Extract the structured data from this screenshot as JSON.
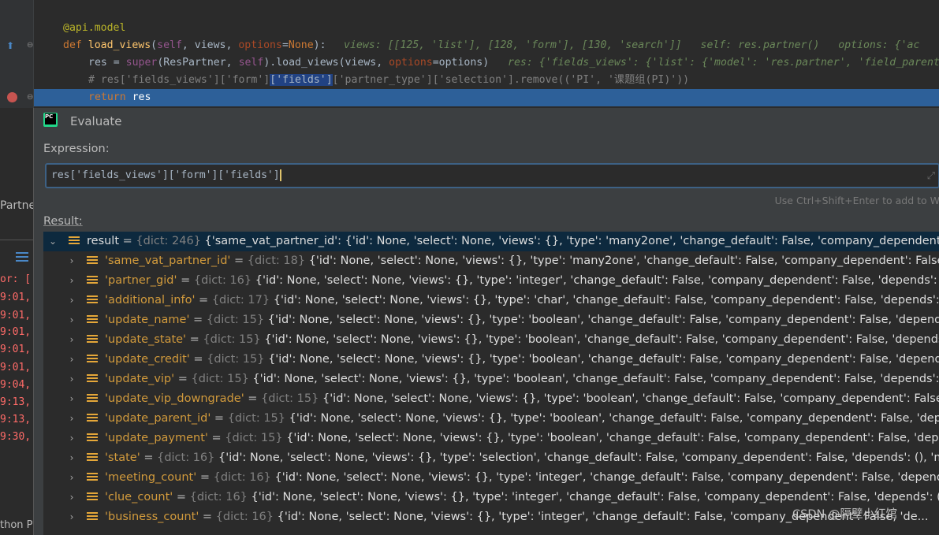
{
  "editor": {
    "lines": [
      {
        "code": "@api.model"
      },
      {
        "code": "def load_views(self, views, options=None):",
        "hint": "views: [[125, 'list'], [128, 'form'], [130, 'search']]   self: res.partner()   options: {'ac"
      },
      {
        "code": "res = super(ResPartner, self).load_views(views, options=options)",
        "hint": "res: {'fields_views': {'list': {'model': 'res.partner', 'field_parent"
      },
      {
        "code": "# res['fields_views']['form']['fields']['partner_type']['selection'].remove(('PI', '课题组(PI)'))"
      },
      {
        "code": "return res"
      }
    ]
  },
  "left_panel": {
    "partner_label": "Partne",
    "error_fragment": "or: [",
    "time_fragments": [
      "9:01,",
      "9:01,",
      "9:01,",
      "9:01,",
      "9:01,",
      "9:04,",
      "9:13,",
      "9:13,",
      "9:30,"
    ],
    "bottom_fragment": "thon P"
  },
  "dialog": {
    "title": "Evaluate",
    "expression_label": "Expression:",
    "expression_value": "res['fields_views']['form']['fields']",
    "hint": "Use Ctrl+Shift+Enter to add to W",
    "result_label": "Result:",
    "result": {
      "name": "result",
      "type": "{dict: 246}",
      "preview": "{'same_vat_partner_id': {'id': None, 'select': None, 'views': {}, 'type': 'many2one', 'change_default': False, 'company_dependent': Fa..."
    },
    "items": [
      {
        "key": "'same_vat_partner_id'",
        "type": "{dict: 18}",
        "preview": "{'id': None, 'select': None, 'views': {}, 'type': 'many2one', 'change_default': False, 'company_dependent': False, 'c..."
      },
      {
        "key": "'partner_gid'",
        "type": "{dict: 16}",
        "preview": "{'id': None, 'select': None, 'views': {}, 'type': 'integer', 'change_default': False, 'company_dependent': False, 'depends': (), ..."
      },
      {
        "key": "'additional_info'",
        "type": "{dict: 17}",
        "preview": "{'id': None, 'select': None, 'views': {}, 'type': 'char', 'change_default': False, 'company_dependent': False, 'depends': (), ..."
      },
      {
        "key": "'update_name'",
        "type": "{dict: 15}",
        "preview": "{'id': None, 'select': None, 'views': {}, 'type': 'boolean', 'change_default': False, 'company_dependent': False, 'depends': ..."
      },
      {
        "key": "'update_state'",
        "type": "{dict: 15}",
        "preview": "{'id': None, 'select': None, 'views': {}, 'type': 'boolean', 'change_default': False, 'company_dependent': False, 'depends': ..."
      },
      {
        "key": "'update_credit'",
        "type": "{dict: 15}",
        "preview": "{'id': None, 'select': None, 'views': {}, 'type': 'boolean', 'change_default': False, 'company_dependent': False, 'depends' ..."
      },
      {
        "key": "'update_vip'",
        "type": "{dict: 15}",
        "preview": "{'id': None, 'select': None, 'views': {}, 'type': 'boolean', 'change_default': False, 'company_dependent': False, 'depends': ('u..."
      },
      {
        "key": "'update_vip_downgrade'",
        "type": "{dict: 15}",
        "preview": "{'id': None, 'select': None, 'views': {}, 'type': 'boolean', 'change_default': False, 'company_dependent': False, ..."
      },
      {
        "key": "'update_parent_id'",
        "type": "{dict: 15}",
        "preview": "{'id': None, 'select': None, 'views': {}, 'type': 'boolean', 'change_default': False, 'company_dependent': False, 'deper..."
      },
      {
        "key": "'update_payment'",
        "type": "{dict: 15}",
        "preview": "{'id': None, 'select': None, 'views': {}, 'type': 'boolean', 'change_default': False, 'company_dependent': False, 'depen..."
      },
      {
        "key": "'state'",
        "type": "{dict: 16}",
        "preview": "{'id': None, 'select': None, 'views': {}, 'type': 'selection', 'change_default': False, 'company_dependent': False, 'depends': (), 'man..."
      },
      {
        "key": "'meeting_count'",
        "type": "{dict: 16}",
        "preview": "{'id': None, 'select': None, 'views': {}, 'type': 'integer', 'change_default': False, 'company_dependent': False, 'depends' ..."
      },
      {
        "key": "'clue_count'",
        "type": "{dict: 16}",
        "preview": "{'id': None, 'select': None, 'views': {}, 'type': 'integer', 'change_default': False, 'company_dependent': False, 'depends': (), ..."
      },
      {
        "key": "'business_count'",
        "type": "{dict: 16}",
        "preview": "{'id': None, 'select': None, 'views': {}, 'type': 'integer', 'change_default': False, 'company_dependent': False, 'de..."
      }
    ]
  },
  "watermark": "CSDN @隔壁小红馆",
  "colors": {
    "selection": "#0d293e",
    "exec_line": "#2d6099",
    "key": "#d19a3c",
    "dict_icon": "#e5a739"
  }
}
